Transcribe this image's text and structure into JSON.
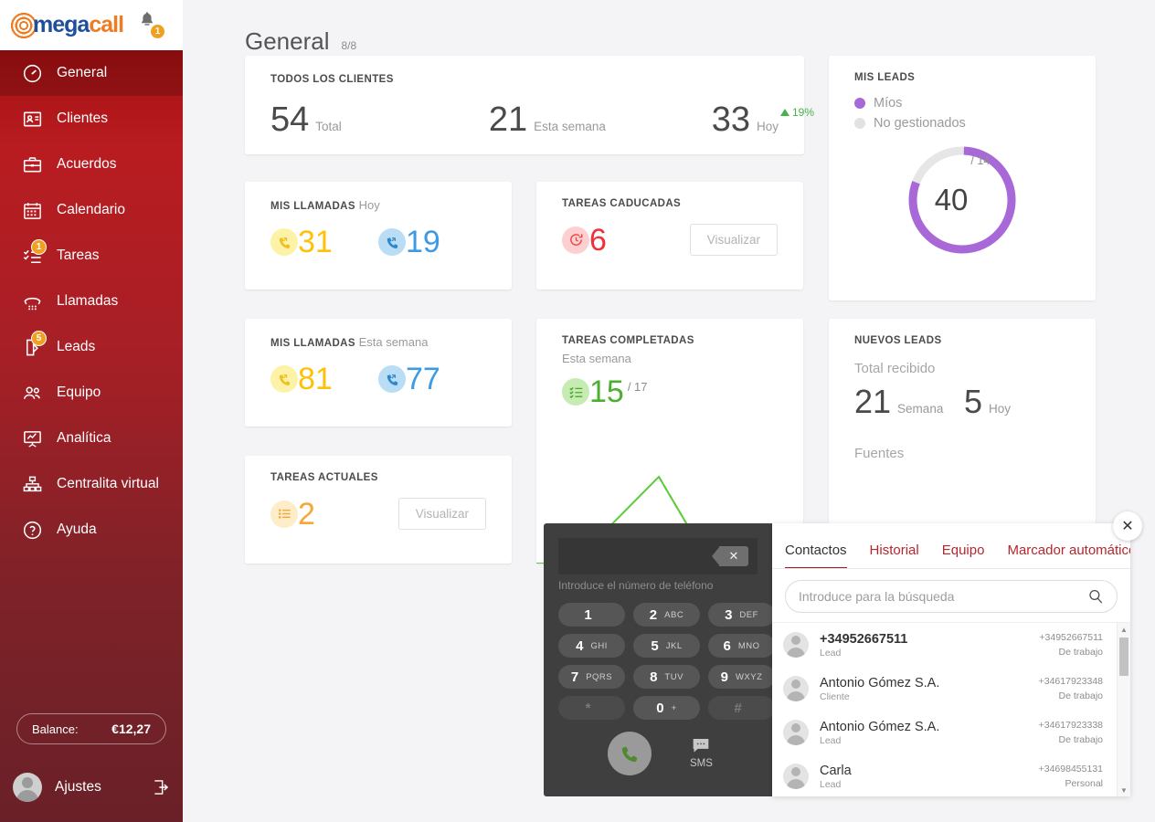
{
  "brand": {
    "name_part1": "mega",
    "name_part2": "call",
    "notification_count": "1"
  },
  "sidebar": {
    "items": [
      {
        "label": "General",
        "icon": "speedometer-icon",
        "badge": null,
        "active": true
      },
      {
        "label": "Clientes",
        "icon": "contact-card-icon",
        "badge": null,
        "active": false
      },
      {
        "label": "Acuerdos",
        "icon": "briefcase-icon",
        "badge": null,
        "active": false
      },
      {
        "label": "Calendario",
        "icon": "calendar-icon",
        "badge": null,
        "active": false
      },
      {
        "label": "Tareas",
        "icon": "checklist-icon",
        "badge": "1",
        "active": false
      },
      {
        "label": "Llamadas",
        "icon": "phone-handset-icon",
        "badge": null,
        "active": false
      },
      {
        "label": "Leads",
        "icon": "door-icon",
        "badge": "5",
        "active": false
      },
      {
        "label": "Equipo",
        "icon": "people-icon",
        "badge": null,
        "active": false
      },
      {
        "label": "Analítica",
        "icon": "chart-board-icon",
        "badge": null,
        "active": false
      },
      {
        "label": "Centralita virtual",
        "icon": "sitemap-icon",
        "badge": null,
        "active": false
      },
      {
        "label": "Ayuda",
        "icon": "question-circle-icon",
        "badge": null,
        "active": false
      }
    ],
    "balance_label": "Balance:",
    "balance_amount": "€12,27",
    "user_name": "Ajustes"
  },
  "header": {
    "title": "General",
    "count": "8/8"
  },
  "cards": {
    "all_clients": {
      "title": "TODOS LOS CLIENTES",
      "total_value": "54",
      "total_label": "Total",
      "week_value": "21",
      "week_label": "Esta semana",
      "today_value": "33",
      "today_label": "Hoy",
      "trend": "19%"
    },
    "calls_today": {
      "title": "MIS LLAMADAS",
      "subtitle": "Hoy",
      "incoming": "31",
      "outgoing": "19"
    },
    "calls_week": {
      "title": "MIS LLAMADAS",
      "subtitle": "Esta semana",
      "incoming": "81",
      "outgoing": "77"
    },
    "tasks_expired": {
      "title": "TAREAS CADUCADAS",
      "value": "6",
      "button": "Visualizar"
    },
    "tasks_current": {
      "title": "TAREAS ACTUALES",
      "value": "2",
      "button": "Visualizar"
    },
    "tasks_done": {
      "title": "TAREAS COMPLETADAS",
      "subtitle": "Esta semana",
      "value": "15",
      "total": "/ 17"
    },
    "my_leads": {
      "title": "MIS LEADS",
      "legend_mine": "Míos",
      "legend_unmanaged": "No gestionados",
      "value": "40",
      "total": "/ 14",
      "color_mine": "#a968d8",
      "color_unmanaged": "#e2e2e2"
    },
    "new_leads": {
      "title": "NUEVOS LEADS",
      "total_label": "Total recibido",
      "week_value": "21",
      "week_label": "Semana",
      "today_value": "5",
      "today_label": "Hoy",
      "sources_label": "Fuentes"
    }
  },
  "chart_data": {
    "type": "line",
    "title": "TAREAS COMPLETADAS",
    "series": [
      {
        "name": "Tareas completadas",
        "values": [
          0,
          6,
          0
        ]
      }
    ],
    "categories": [
      "",
      "",
      ""
    ],
    "color": "#5ecc3a"
  },
  "dialer": {
    "input_value": "",
    "hint": "Introduce el número de teléfono",
    "backspace_icon": "backspace-icon",
    "keys": [
      {
        "digit": "1",
        "letters": ""
      },
      {
        "digit": "2",
        "letters": "ABC"
      },
      {
        "digit": "3",
        "letters": "DEF"
      },
      {
        "digit": "4",
        "letters": "GHI"
      },
      {
        "digit": "5",
        "letters": "JKL"
      },
      {
        "digit": "6",
        "letters": "MNO"
      },
      {
        "digit": "7",
        "letters": "PQRS"
      },
      {
        "digit": "8",
        "letters": "TUV"
      },
      {
        "digit": "9",
        "letters": "WXYZ"
      },
      {
        "digit": "*",
        "letters": ""
      },
      {
        "digit": "0",
        "letters": "+"
      },
      {
        "digit": "#",
        "letters": ""
      }
    ],
    "call_icon": "phone-call-icon",
    "sms_label": "SMS"
  },
  "contacts_panel": {
    "tabs": [
      {
        "label": "Contactos",
        "active": true
      },
      {
        "label": "Historial",
        "active": false
      },
      {
        "label": "Equipo",
        "active": false
      },
      {
        "label": "Marcador automático",
        "active": false
      }
    ],
    "search_placeholder": "Introduce para la búsqueda",
    "contacts": [
      {
        "name": "+34952667511",
        "role": "Lead",
        "number": "+34952667511",
        "type": "De trabajo"
      },
      {
        "name": "Antonio Gómez S.A.",
        "role": "Cliente",
        "number": "+34617923348",
        "type": "De trabajo"
      },
      {
        "name": "Antonio Gómez S.A.",
        "role": "Lead",
        "number": "+34617923338",
        "type": "De trabajo"
      },
      {
        "name": "Carla",
        "role": "Lead",
        "number": "+34698455131",
        "type": "Personal"
      }
    ],
    "close_label": "✕"
  }
}
